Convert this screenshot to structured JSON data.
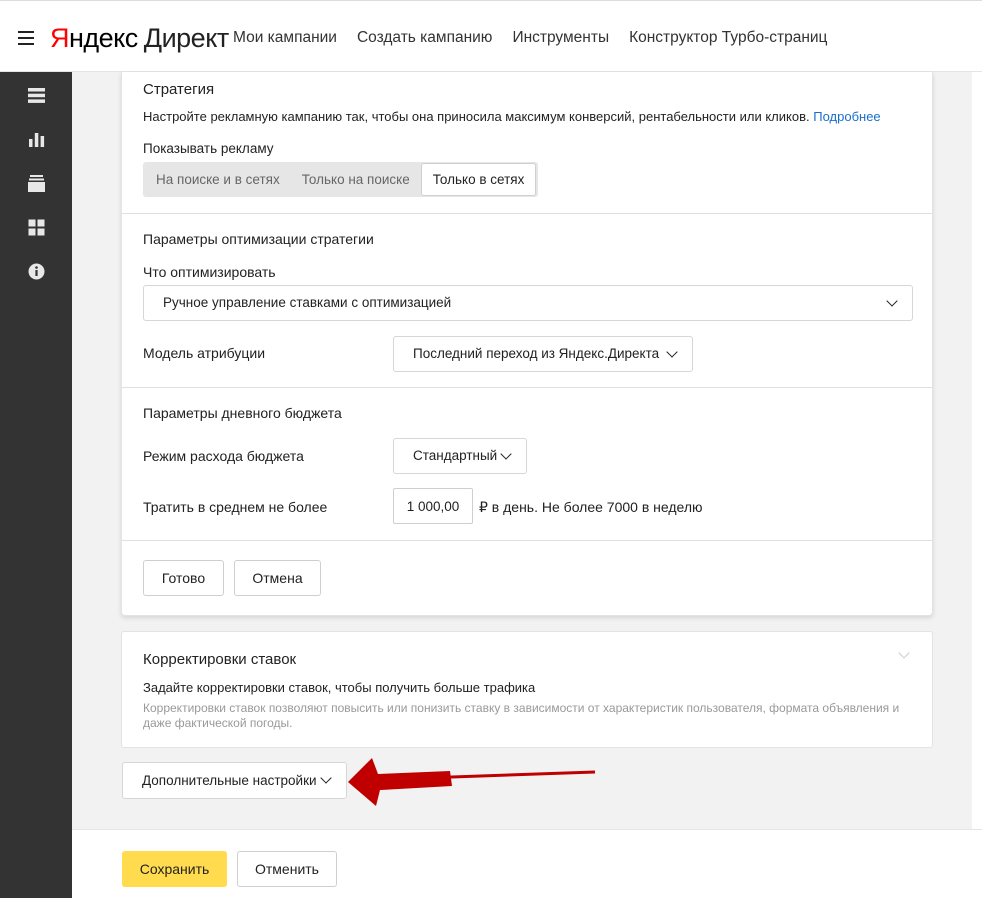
{
  "header": {
    "logo_yandex_first": "Я",
    "logo_yandex_rest": "ндекс",
    "logo_direct": "Директ",
    "nav": [
      "Мои кампании",
      "Создать кампанию",
      "Инструменты",
      "Конструктор Турбо-страниц"
    ]
  },
  "sidebar": {
    "icons": [
      "list-icon",
      "stats-icon",
      "archive-icon",
      "apps-icon",
      "info-icon"
    ]
  },
  "strategy": {
    "title": "Стратегия",
    "description": "Настройте рекламную кампанию так, чтобы она приносила максимум конверсий, рентабельности или кликов.",
    "more_link": "Подробнее",
    "show_ads_label": "Показывать рекламу",
    "show_ads_options": [
      "На поиске и в сетях",
      "Только на поиске",
      "Только в сетях"
    ],
    "show_ads_selected": "Только в сетях"
  },
  "optimization": {
    "title": "Параметры оптимизации стратегии",
    "what_label": "Что оптимизировать",
    "what_value": "Ручное управление ставками с оптимизацией",
    "attribution_label": "Модель атрибуции",
    "attribution_value": "Последний переход из Яндекс.Директа"
  },
  "budget": {
    "title": "Параметры дневного бюджета",
    "mode_label": "Режим расхода бюджета",
    "mode_value": "Стандартный",
    "spend_label": "Тратить в среднем не более",
    "spend_value": "1 000,00",
    "spend_suffix": "₽ в день. Не более 7000 в неделю"
  },
  "strategy_actions": {
    "done": "Готово",
    "cancel": "Отмена"
  },
  "bids": {
    "title": "Корректировки ставок",
    "subtitle": "Задайте корректировки ставок, чтобы получить больше трафика",
    "hint": "Корректировки ставок позволяют повысить или понизить ставку в зависимости от характеристик пользователя, формата объявления и даже фактической погоды."
  },
  "advanced": {
    "label": "Дополнительные настройки"
  },
  "footer": {
    "save": "Сохранить",
    "cancel": "Отменить"
  },
  "colors": {
    "accent_yellow": "#ffdb4d",
    "link_blue": "#1a6ecb",
    "sidebar": "#333333",
    "annotation_arrow": "#c00000"
  }
}
